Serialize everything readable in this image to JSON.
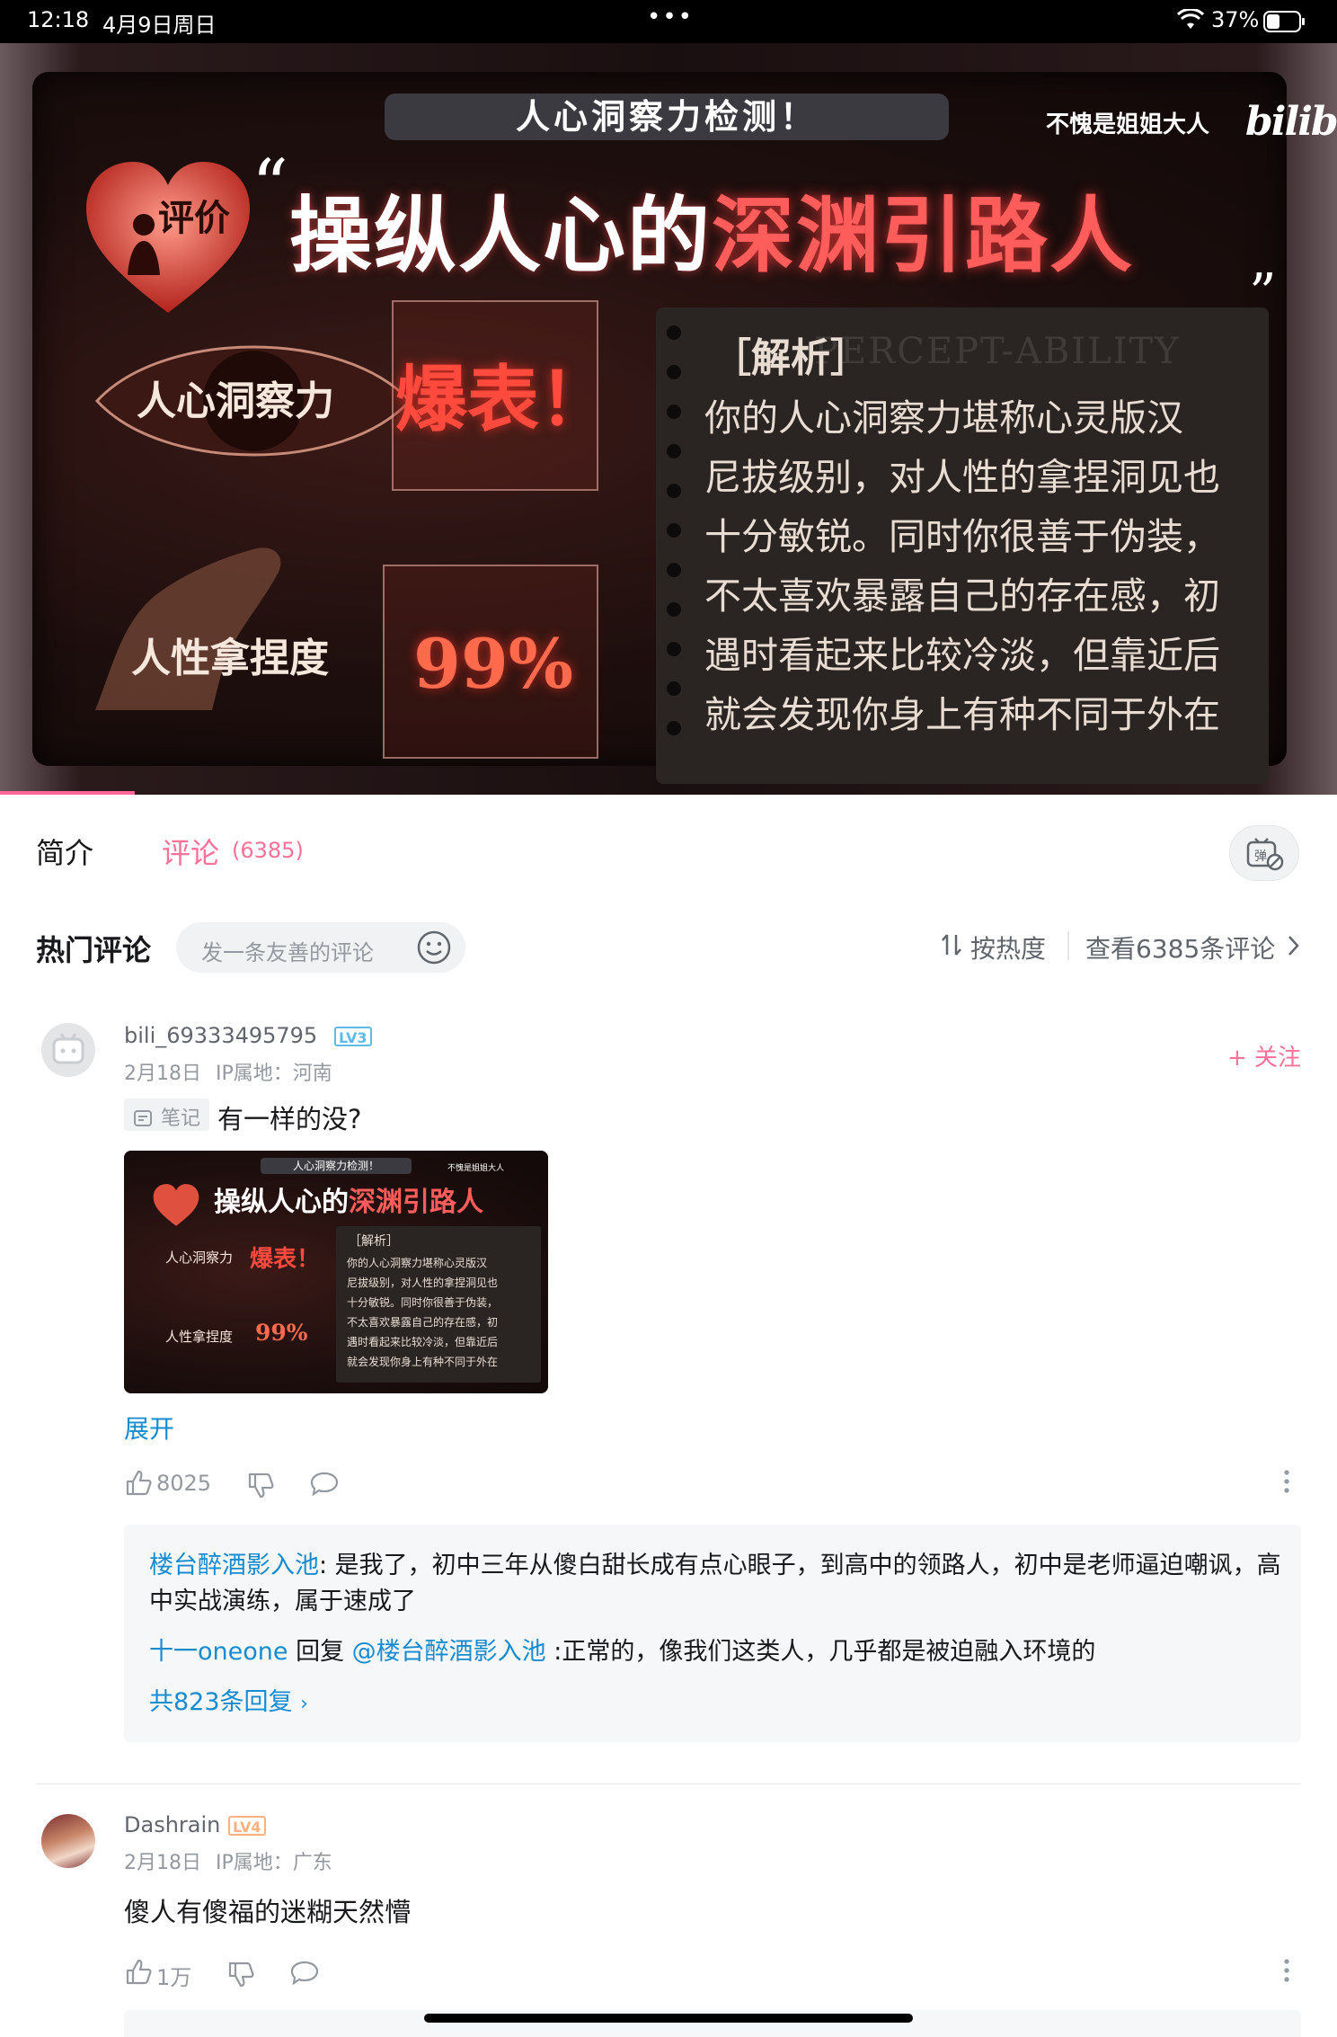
{
  "status_bar": {
    "time": "12:18",
    "date": "4月9日周日",
    "dots": "•••",
    "battery": "37%"
  },
  "video": {
    "badge": "人心洞察力检测！",
    "creator": "不愧是姐姐大人",
    "logo": "bilibili",
    "heart_label": "评价",
    "quote_open": "“",
    "quote_close": "”",
    "headline_a": "操纵人心的",
    "headline_b": "深渊引路人",
    "metric1_label": "人心洞察力",
    "metric1_value": "爆表！",
    "metric2_label": "人性拿捏度",
    "metric2_value": "99%",
    "panel_title": "［解析］",
    "panel_watermark": "PERCEPT-ABILITY",
    "panel_lines": [
      "你的人心洞察力堪称心灵版汉",
      "尼拔级别，对人性的拿捏洞见也",
      "十分敏锐。同时你很善于伪装，",
      "不太喜欢暴露自己的存在感，初",
      "遇时看起来比较冷淡，但靠近后",
      "就会发现你身上有种不同于外在"
    ]
  },
  "tabs": {
    "intro": "简介",
    "comments": "评论",
    "comments_count": "(6385)"
  },
  "hot": {
    "title": "热门评论",
    "input_placeholder": "发一条友善的评论",
    "sort": "按热度",
    "view_all": "查看6385条评论"
  },
  "comments": [
    {
      "username": "bili_69333495795",
      "level": "LV3",
      "date": "2月18日",
      "ip": "IP属地：河南",
      "follow": "+ 关注",
      "note_tag": "笔记",
      "text": "有一样的没?",
      "expand": "展开",
      "likes": "8025",
      "replies": [
        {
          "name": "楼台醉酒影入池",
          "text": ": 是我了，初中三年从傻白甜长成有点心眼子，到高中的领路人，初中是老师逼迫嘲讽，高中实战演练，属于速成了"
        },
        {
          "name": "十一oneone",
          "reply_word": " 回复 ",
          "mention": "@楼台醉酒影入池",
          "text": " :正常的，像我们这类人，几乎都是被迫融入环境的"
        }
      ],
      "reply_count": "共823条回复"
    },
    {
      "username": "Dashrain",
      "level": "LV4",
      "date": "2月18日",
      "ip": "IP属地：广东",
      "text": "傻人有傻福的迷糊天然懵",
      "likes": "1万"
    }
  ],
  "colors": {
    "accent": "#fb7299",
    "link": "#178bcf",
    "lv3": "#5ebbe6",
    "lv4": "#ffb27f"
  }
}
